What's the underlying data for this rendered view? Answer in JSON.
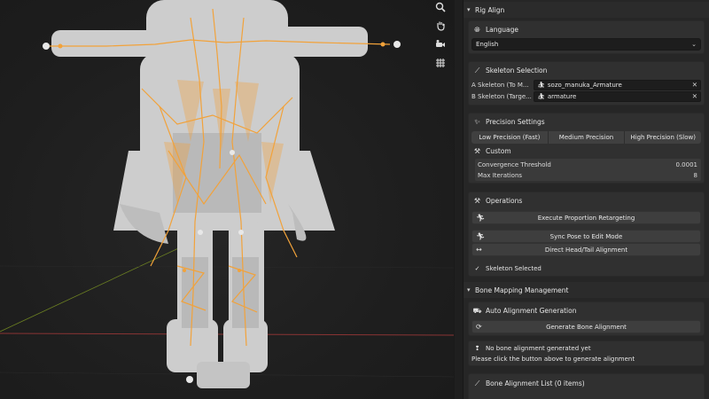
{
  "panel": {
    "title": "Rig Align",
    "language": {
      "header": "Language",
      "selected": "English"
    },
    "skeleton_selection": {
      "header": "Skeleton Selection",
      "a_label": "A Skeleton (To M...",
      "a_value": "sozo_manuka_Armature",
      "b_label": "B Skeleton (Targe...",
      "b_value": "armature"
    },
    "precision": {
      "header": "Precision Settings",
      "options": [
        "Low Precision (Fast)",
        "Medium Precision",
        "High Precision (Slow)"
      ],
      "custom_label": "Custom",
      "threshold_label": "Convergence Threshold",
      "threshold_value": "0.0001",
      "iterations_label": "Max Iterations",
      "iterations_value": "8"
    },
    "operations": {
      "header": "Operations",
      "execute": "Execute Proportion Retargeting",
      "sync": "Sync Pose to Edit Mode",
      "direct": "Direct Head/Tail Alignment",
      "status": "Skeleton Selected"
    },
    "bone_mapping": {
      "header": "Bone Mapping Management",
      "auto_label": "Auto Alignment Generation",
      "generate": "Generate Bone Alignment",
      "no_alignment": "No bone alignment generated yet",
      "hint": "Please click the button above to generate alignment",
      "list_label": "Bone Alignment List (0 items)"
    }
  },
  "viewport_tools": [
    "magnify-icon",
    "hand-icon",
    "camera-icon",
    "grid-icon"
  ],
  "colors": {
    "bone": "#f2a23a",
    "mesh": "#cfcfcf",
    "panel_bg": "#262626",
    "axis_x": "#9a3838",
    "axis_y": "#7a8f2a"
  }
}
